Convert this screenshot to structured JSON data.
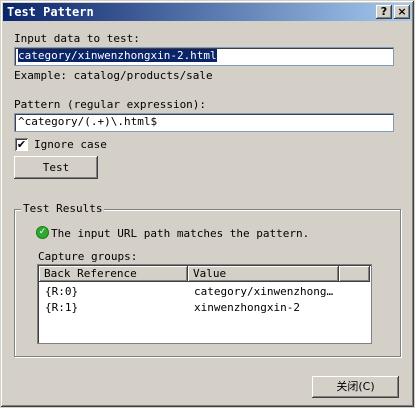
{
  "window": {
    "title": "Test Pattern",
    "help_label": "?",
    "close_label": "×"
  },
  "input_section": {
    "label": "Input data to test:",
    "value": "category/xinwenzhongxin-2.html",
    "example": "Example: catalog/products/sale"
  },
  "pattern_section": {
    "label": "Pattern (regular expression):",
    "value": "^category/(.+)\\.html$"
  },
  "ignore_case": {
    "label": "Ignore case",
    "checked": true,
    "check_glyph": "✔"
  },
  "test_button": {
    "label": "Test"
  },
  "results": {
    "group_title": "Test Results",
    "status_icon": "check-circle-icon",
    "status_text": "The input URL path matches the pattern.",
    "capture_groups_label": "Capture groups:",
    "columns": [
      "Back Reference",
      "Value"
    ],
    "rows": [
      {
        "ref": "{R:0}",
        "value": "category/xinwenzhong..."
      },
      {
        "ref": "{R:1}",
        "value": "xinwenzhongxin-2"
      }
    ]
  },
  "close_button": {
    "label": "关闭(C)"
  },
  "colors": {
    "titlebar_start": "#0a246a",
    "titlebar_end": "#a6caf0",
    "dialog_bg": "#d4d0c8",
    "success": "#2fa82f"
  }
}
